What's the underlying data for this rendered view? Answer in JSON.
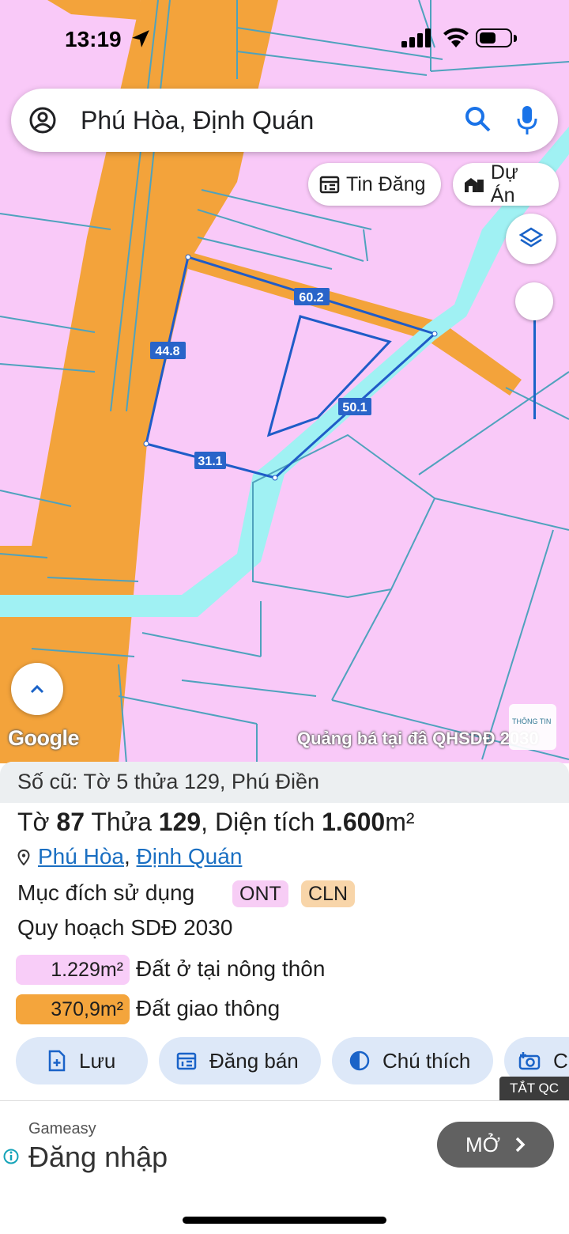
{
  "status_bar": {
    "time": "13:19"
  },
  "search": {
    "query": "Phú Hòa, Định Quán"
  },
  "chips": {
    "listings": "Tin Đăng",
    "projects": "Dự Án"
  },
  "map": {
    "edge_labels": [
      "60.2",
      "44.8",
      "50.1",
      "31.1"
    ],
    "google_label": "Google",
    "ad_overlay": "Quảng bá tại đâ QHSDĐ 2030",
    "badge_text": "THÔNG TIN",
    "colors": {
      "residential": "#f9c9f8",
      "road": "#f3a33b",
      "water": "#a0f1f3",
      "boundary": "#1f5cc8"
    }
  },
  "panel": {
    "old_info": "Số cũ: Tờ 5 thửa 129, Phú Điền",
    "title": {
      "sheet_label": "Tờ",
      "sheet": "87",
      "parcel_label": "Thửa",
      "parcel": "129",
      "area_label": ", Diện tích",
      "area": "1.600",
      "unit": "m²"
    },
    "address": {
      "commune": "Phú Hòa",
      "sep": ",",
      "district": "Định Quán"
    },
    "purpose_label": "Mục đích sử dụng",
    "tags": [
      "ONT",
      "CLN"
    ],
    "plan_label": "Quy hoạch SDĐ 2030",
    "areas": [
      {
        "value": "1.229m²",
        "desc": "Đất ở tại nông thôn"
      },
      {
        "value": "370,9m²",
        "desc": "Đất giao thông"
      }
    ],
    "buttons": {
      "save": "Lưu",
      "sell": "Đăng bán",
      "legend": "Chú thích",
      "more": "C"
    },
    "hide_ads": "TẮT QC"
  },
  "ad": {
    "brand": "Gameasy",
    "headline": "Đăng nhập",
    "cta": "MỞ"
  }
}
